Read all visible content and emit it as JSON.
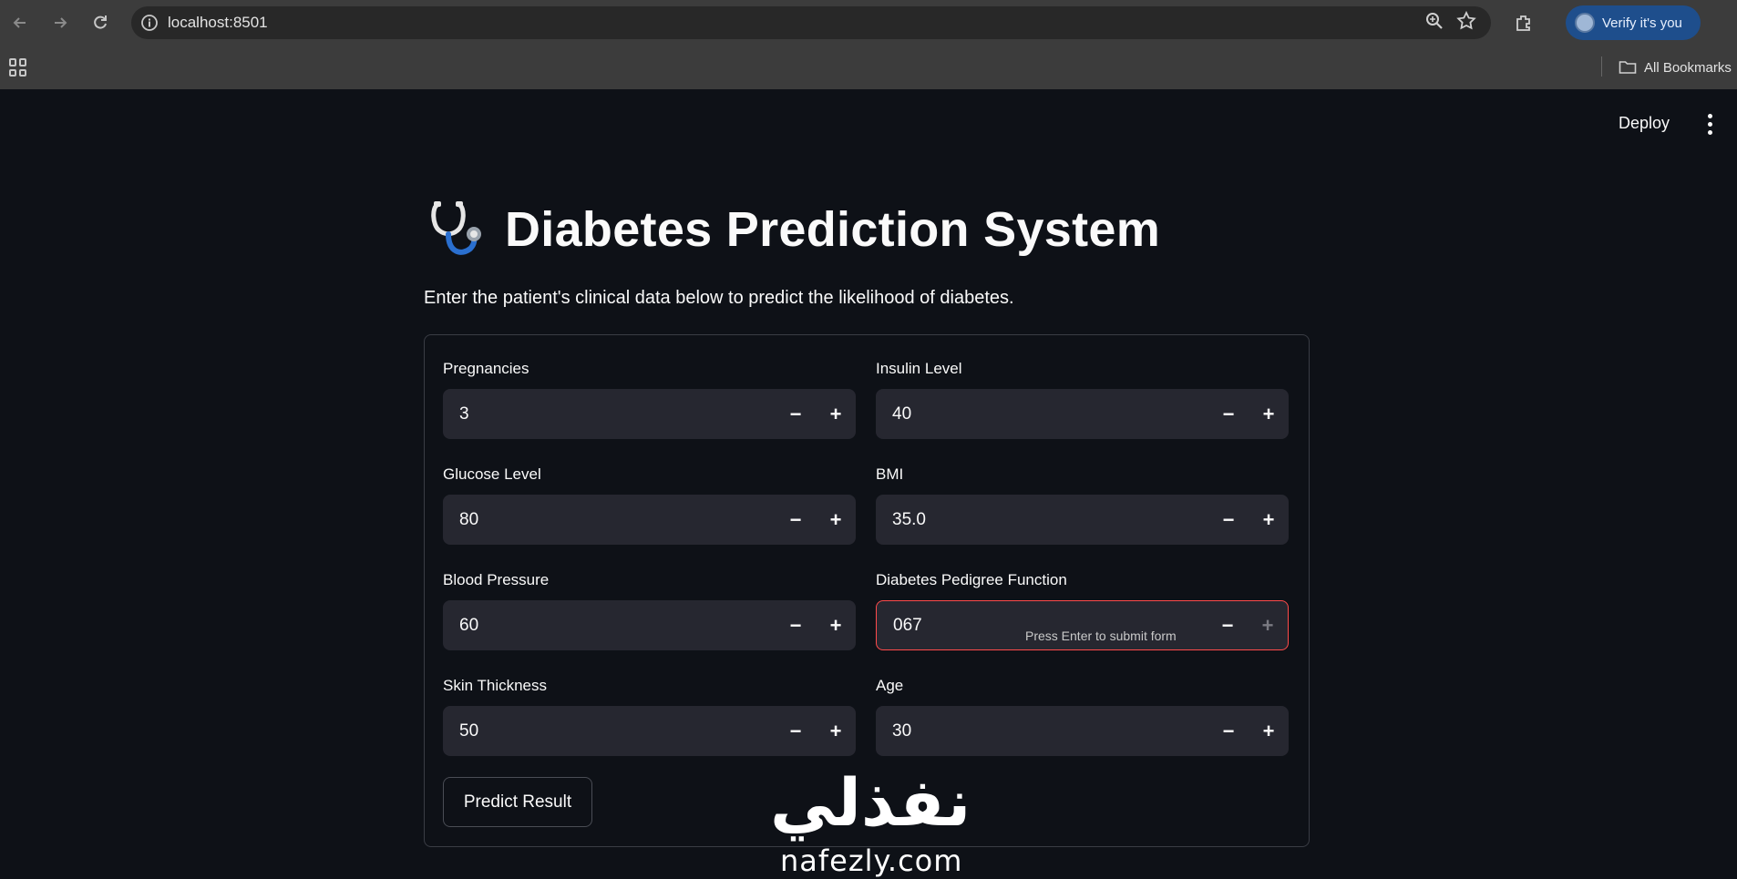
{
  "browser": {
    "url": "localhost:8501",
    "profile_chip": "Verify it's you",
    "bookmarks_label": "All Bookmarks"
  },
  "app": {
    "deploy_label": "Deploy",
    "title_icon": "stethoscope-icon",
    "title": "Diabetes Prediction System",
    "subtitle": "Enter the patient's clinical data below to predict the likelihood of diabetes.",
    "form": {
      "fields": [
        {
          "label": "Pregnancies",
          "value": "3"
        },
        {
          "label": "Glucose Level",
          "value": "80"
        },
        {
          "label": "Blood Pressure",
          "value": "60"
        },
        {
          "label": "Skin Thickness",
          "value": "50"
        },
        {
          "label": "Insulin Level",
          "value": "40"
        },
        {
          "label": "BMI",
          "value": "35.0"
        },
        {
          "label": "Diabetes Pedigree Function",
          "value": "067"
        },
        {
          "label": "Age",
          "value": "30"
        }
      ],
      "minus_symbol": "−",
      "plus_symbol": "+",
      "hint": "Press Enter to submit form",
      "submit_label": "Predict Result"
    }
  },
  "watermark": {
    "arabic": "نفذلي",
    "latin": "nafezly.com"
  },
  "colors": {
    "background": "#0e1117",
    "input_bg": "#262730",
    "focus_border": "#ff4b4b",
    "chrome": "#3c3c3c"
  }
}
